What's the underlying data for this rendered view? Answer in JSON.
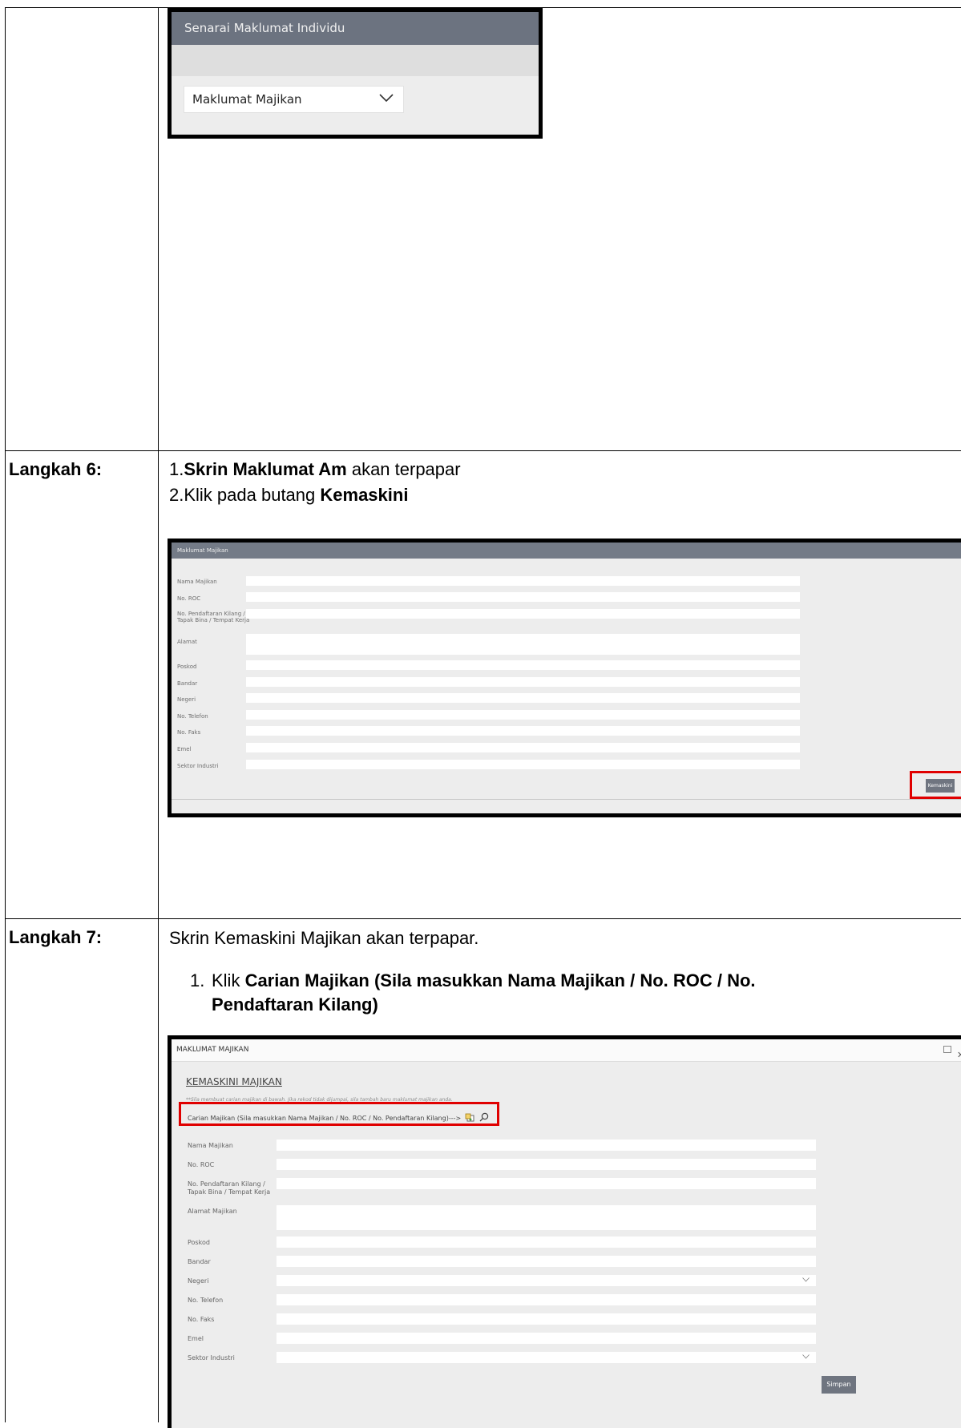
{
  "steps": {
    "step6": {
      "label": "Langkah 6:",
      "line1_num": "1.",
      "line1_bold": "Skrin Maklumat Am",
      "line1_rest": " akan terpapar",
      "line2_num": "2.",
      "line2_text": "Klik pada butang ",
      "line2_bold": "Kemaskini"
    },
    "step7": {
      "label": "Langkah 7:",
      "intro": "Skrin Kemaskini Majikan akan terpapar.",
      "item_num": "1.",
      "item_text": "Klik ",
      "item_bold_line1": "Carian Majikan (Sila masukkan Nama Majikan / No. ROC / No.",
      "item_bold_line2": "Pendaftaran Kilang)"
    }
  },
  "screenshot1": {
    "header": "Senarai Maklumat Individu",
    "select_value": "Maklumat Majikan",
    "select_icon": "chevron-down-icon"
  },
  "screenshot2": {
    "header": "Maklumat Majikan",
    "fields": [
      {
        "label": "Nama Majikan"
      },
      {
        "label": "No. ROC"
      },
      {
        "label": "No. Pendaftaran Kilang /\nTapak Bina / Tempat Kerja"
      },
      {
        "label": "Alamat"
      },
      {
        "label": "Poskod"
      },
      {
        "label": "Bandar"
      },
      {
        "label": "Negeri"
      },
      {
        "label": "No. Telefon"
      },
      {
        "label": "No. Faks"
      },
      {
        "label": "Emel"
      },
      {
        "label": "Sektor Industri"
      }
    ],
    "button": "Kemaskini",
    "highlight_color": "#e00000"
  },
  "screenshot3": {
    "window_title": "MAKLUMAT MAJIKAN",
    "title": "KEMASKINI MAJIKAN",
    "note": "**Sila membuat carian majikan di bawah. Jika rekod tidak dijumpai, sila tambah baru maklumat majikan anda.",
    "search_label": "Carian Majikan (Sila masukkan Nama Majikan / No. ROC / No. Pendaftaran Kilang)--->",
    "search_icons": [
      "add-record-icon",
      "search-icon"
    ],
    "fields": [
      {
        "label": "Nama Majikan"
      },
      {
        "label": "No. ROC"
      },
      {
        "label": "No. Pendaftaran Kilang /\nTapak Bina / Tempat Kerja"
      },
      {
        "label": "Alamat Majikan"
      },
      {
        "label": "Poskod"
      },
      {
        "label": "Bandar"
      },
      {
        "label": "Negeri"
      },
      {
        "label": "No. Telefon"
      },
      {
        "label": "No. Faks"
      },
      {
        "label": "Emel"
      },
      {
        "label": "Sektor Industri"
      }
    ],
    "button": "Simpan",
    "highlight_color": "#e00000"
  }
}
